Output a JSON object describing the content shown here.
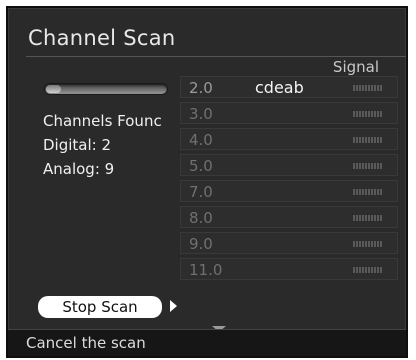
{
  "window": {
    "title": "Channel Scan"
  },
  "header": {
    "signal_label": "Signal"
  },
  "scan": {
    "progress": 0.12,
    "channels_found_label": "Channels Founc",
    "digital_label": "Digital: 2",
    "analog_label": "Analog: 9"
  },
  "channels": [
    {
      "number": "2.0",
      "name": "cdeab",
      "active": true
    },
    {
      "number": "3.0",
      "name": "",
      "active": false
    },
    {
      "number": "4.0",
      "name": "",
      "active": false
    },
    {
      "number": "5.0",
      "name": "",
      "active": false
    },
    {
      "number": "7.0",
      "name": "",
      "active": false
    },
    {
      "number": "8.0",
      "name": "",
      "active": false
    },
    {
      "number": "9.0",
      "name": "",
      "active": false
    },
    {
      "number": "11.0",
      "name": "",
      "active": false
    }
  ],
  "actions": {
    "stop_label": "Stop Scan"
  },
  "footer": {
    "hint": "Cancel the scan"
  },
  "icons": {
    "scroll_down": "chevron-down-icon",
    "button_indicator": "triangle-right-icon"
  },
  "colors": {
    "background": "#2a2a2a",
    "text": "#f0f0f0",
    "button": "#ffffff"
  }
}
